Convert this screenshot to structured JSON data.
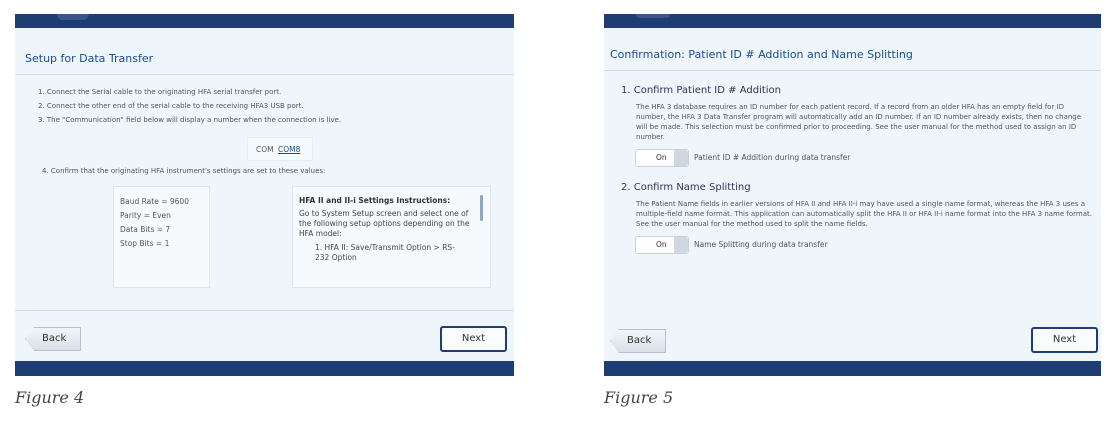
{
  "figure4": {
    "title": "Setup for Data Transfer",
    "steps": [
      "1.  Connect the Serial cable to the originating HFA serial transfer port.",
      "2.  Connect the other end of the serial cable to the receiving HFA3 USB port.",
      "3.  The \"Communication\" field below will display a number when the connection is live."
    ],
    "com_label": "COM",
    "com_value": "COM8",
    "step4": "4. Confirm that the originating HFA instrument's settings are set to these values:",
    "settings": [
      "Baud Rate = 9600",
      "Parity = Even",
      "Data Bits = 7",
      "Stop Bits = 1"
    ],
    "instructions_title": "HFA II and II-i Settings Instructions:",
    "instructions_text": "Go to System Setup screen and select one of the following setup options depending on the HFA model:",
    "instructions_option": "1.  HFA II: Save/Transmit Option > RS-232 Option",
    "back_label": "Back",
    "next_label": "Next",
    "caption": "Figure 4"
  },
  "figure5": {
    "title": "Confirmation: Patient ID # Addition and Name Splitting",
    "section1_heading": "1.  Confirm Patient ID # Addition",
    "section1_text": "The HFA 3 database requires an ID number for each patient record.  If a record from an older HFA has an empty field for ID number, the HFA 3 Data Transfer program will automatically add an ID number.  If an ID number already exists, then no change will be made.  This selection must be confirmed prior to proceeding.  See the user manual for the method used to assign an ID number.",
    "toggle1_state": "On",
    "toggle1_label": "Patient ID # Addition during data transfer",
    "section2_heading": "2.  Confirm Name Splitting",
    "section2_text": "The Patient Name fields in earlier versions of HFA II and HFA II-i may have used a single name format, whereas the HFA 3 uses a multiple-field name format.  This application can automatically split the HFA II or HFA II-i name format into the HFA 3 name format. See the user manual for the method used to split the name fields.",
    "toggle2_state": "On",
    "toggle2_label": "Name Splitting during data transfer",
    "back_label": "Back",
    "next_label": "Next",
    "caption": "Figure 5"
  },
  "colors": {
    "header_bar": "#1e3d73",
    "panel_bg": "#eef5fb",
    "title_blue": "#1a4e8a"
  }
}
